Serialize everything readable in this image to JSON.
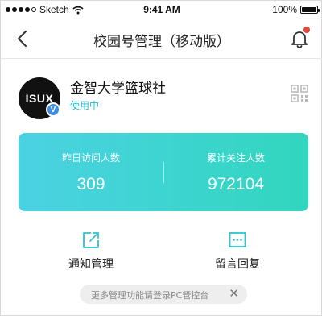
{
  "status_bar": {
    "carrier": "Sketch",
    "time": "9:41 AM",
    "battery": "100%",
    "signal_icon": "signal-dots-icon",
    "wifi_icon": "wifi-icon",
    "battery_icon": "battery-icon"
  },
  "nav": {
    "title": "校园号管理（移动版）",
    "back_icon": "back-chevron-icon",
    "bell_icon": "bell-icon",
    "has_notification": true
  },
  "profile": {
    "avatar_text": "ISUX",
    "verified_badge": "V",
    "name": "金智大学篮球社",
    "status": "使用中",
    "qr_icon": "qr-code-icon"
  },
  "stats": [
    {
      "label": "昨日访问人数",
      "value": "309"
    },
    {
      "label": "累计关注人数",
      "value": "972104"
    }
  ],
  "actions": [
    {
      "label": "通知管理",
      "icon": "edit-square-icon"
    },
    {
      "label": "留言回复",
      "icon": "message-dots-icon"
    }
  ],
  "tip": {
    "text": "更多管理功能请登录PC管控台",
    "close": "✕"
  },
  "colors": {
    "accent_start": "#4bd2e3",
    "accent_end": "#31d6be",
    "status_text": "#27b8c8",
    "notification_dot": "#e8462e",
    "verified_badge": "#3d8ee8"
  }
}
